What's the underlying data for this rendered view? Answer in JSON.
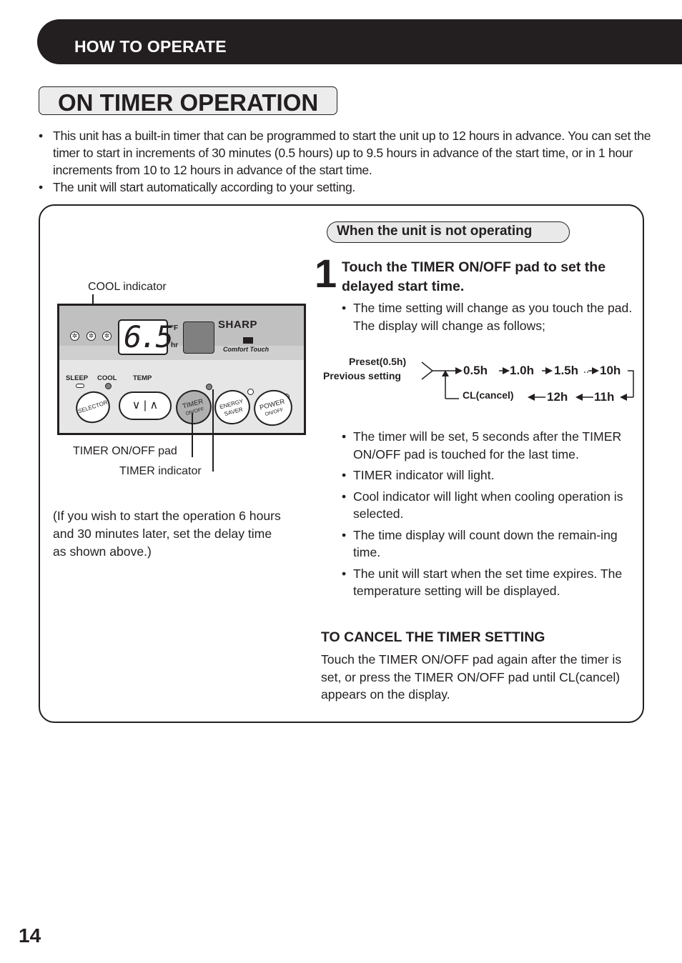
{
  "header": {
    "section": "HOW TO OPERATE"
  },
  "title": "ON TIMER OPERATION",
  "intro": [
    "This unit has a built-in timer that can be programmed to start the unit up to 12 hours in advance. You can set the timer to start in increments of 30 minutes (0.5 hours) up to 9.5 hours in advance of the start time, or in 1 hour increments from 10 to 12 hours in advance of the start time.",
    "The unit will start automatically according to your setting."
  ],
  "bullet_char": "•",
  "diagram": {
    "display_value": "6.5",
    "unit_f": "°F",
    "unit_hr": "hr",
    "brand": "SHARP",
    "brand_sub": "Comfort Touch",
    "labels": {
      "sleep": "SLEEP",
      "cool": "COOL",
      "temp": "TEMP"
    },
    "pads": {
      "selector": "SELECTOR",
      "temp_down": "∨",
      "temp_sep": "|",
      "temp_up": "∧",
      "timer": "TIMER",
      "timer_sub": "ON/OFF",
      "energy1": "ENERGY",
      "energy2": "SAVER",
      "power": "POWER",
      "power_sub": "ON/OFF"
    },
    "callouts": {
      "cool_indicator": "COOL indicator",
      "timer_pad": "TIMER ON/OFF pad",
      "timer_indicator": "TIMER indicator"
    }
  },
  "example_note": "(If you wish to start the operation 6 hours and 30 minutes later, set the delay time as shown above.)",
  "condition": "When the unit is not operating",
  "step": {
    "number": "1",
    "title": "Touch the TIMER ON/OFF pad to set the delayed start time.",
    "bullets_before": [
      "The time setting will change as you touch the pad. The display will change as follows;"
    ],
    "sequence": {
      "start_labels": [
        "Preset(0.5h)",
        "Previous setting"
      ],
      "forward": [
        "0.5h",
        "1.0h",
        "1.5h",
        "10h"
      ],
      "backward": [
        "11h",
        "12h",
        "CL(cancel)"
      ]
    },
    "bullets_after": [
      "The timer will be set, 5 seconds after the TIMER ON/OFF pad is touched for the last time.",
      "TIMER indicator will light.",
      "Cool indicator will light when cooling operation is selected.",
      "The time display will count down the remain-ing time.",
      "The unit will start when the set time expires. The temperature setting will be displayed."
    ]
  },
  "cancel": {
    "heading": "TO CANCEL THE TIMER SETTING",
    "text": "Touch the TIMER ON/OFF pad again after the timer is set, or press the TIMER ON/OFF pad until CL(cancel) appears on the display."
  },
  "page_number": "14"
}
